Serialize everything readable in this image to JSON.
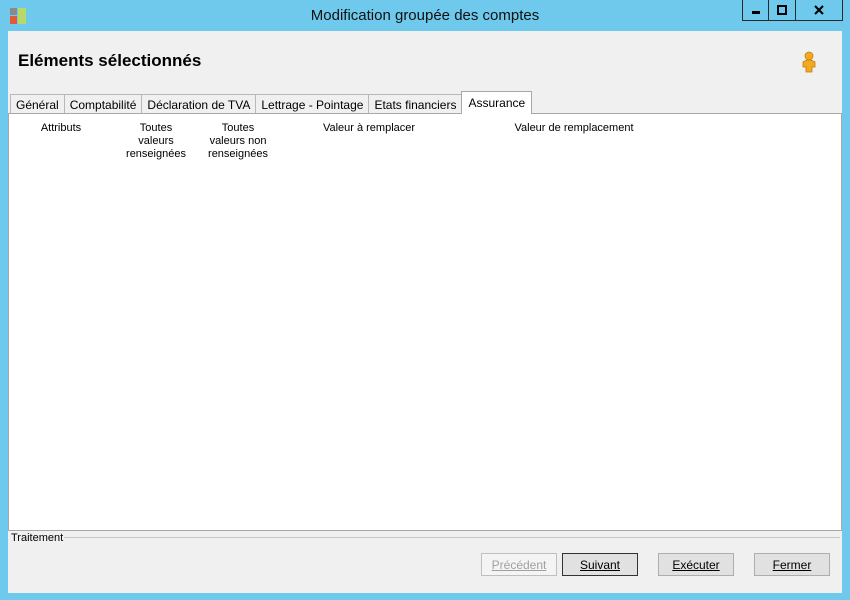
{
  "window": {
    "title": "Modification groupée des comptes"
  },
  "header": {
    "title": "Eléments sélectionnés"
  },
  "tabs": [
    {
      "label": "Général",
      "active": false
    },
    {
      "label": "Comptabilité",
      "active": false
    },
    {
      "label": "Déclaration de TVA",
      "active": false
    },
    {
      "label": "Lettrage - Pointage",
      "active": false
    },
    {
      "label": "Etats financiers",
      "active": false
    },
    {
      "label": "Assurance",
      "active": true
    }
  ],
  "columns": {
    "attributs": "Attributs",
    "toutes_renseignees": "Toutes valeurs renseignées",
    "toutes_non_renseignees": "Toutes valeurs non renseignées",
    "valeur_a_remplacer": "Valeur à remplacer",
    "valeur_de_remplacement": "Valeur de remplacement"
  },
  "footer": {
    "group_label": "Traitement",
    "buttons": {
      "precedent": "Précédent",
      "suivant": "Suivant",
      "executer": "Exécuter",
      "fermer": "Fermer"
    }
  },
  "colors": {
    "titlebar": "#6ec9ec",
    "client": "#f0f0f0"
  },
  "icons": {
    "app": "app-icon",
    "user": "user-icon"
  }
}
